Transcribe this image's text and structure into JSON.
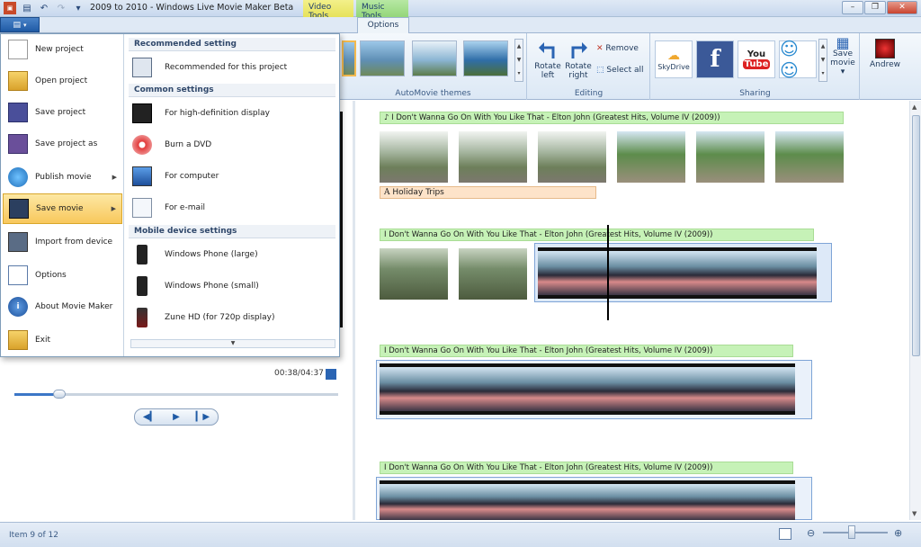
{
  "window": {
    "title": "2009 to 2010 - Windows Live Movie Maker Beta"
  },
  "context_tabs": {
    "video": "Video Tools",
    "music": "Music Tools"
  },
  "ribbon": {
    "active_tab": "Options",
    "groups": {
      "themes": "AutoMovie themes",
      "editing": "Editing",
      "sharing": "Sharing"
    },
    "editing": {
      "rotate_left": [
        "Rotate",
        "left"
      ],
      "rotate_right": [
        "Rotate",
        "right"
      ],
      "remove": "Remove",
      "select_all": "Select all"
    },
    "sharing": {
      "skydrive": "SkyDrive",
      "save_movie": [
        "Save",
        "movie"
      ],
      "user": "Andrew"
    }
  },
  "file_menu": {
    "left": [
      {
        "label": "New project"
      },
      {
        "label": "Open project"
      },
      {
        "label": "Save project"
      },
      {
        "label": "Save project as"
      },
      {
        "label": "Publish movie",
        "submenu": true
      },
      {
        "label": "Save movie",
        "submenu": true,
        "active": true
      },
      {
        "label": "Import from device"
      },
      {
        "label": "Options"
      },
      {
        "label": "About Movie Maker"
      },
      {
        "label": "Exit"
      }
    ],
    "right": {
      "recommended_header": "Recommended setting",
      "recommended_item": "Recommended for this project",
      "common_header": "Common settings",
      "common": [
        "For high-definition display",
        "Burn a DVD",
        "For computer",
        "For e-mail"
      ],
      "mobile_header": "Mobile device settings",
      "mobile": [
        "Windows Phone (large)",
        "Windows Phone (small)",
        "Zune HD (for 720p display)"
      ]
    }
  },
  "player": {
    "timecode": "00:38/04:37",
    "position": 0.14
  },
  "storyboard": {
    "music_track": "I Don't Wanna Go On With You Like That - Elton John (Greatest Hits, Volume IV (2009))",
    "caption": "Holiday Trips"
  },
  "status": {
    "item": "Item 9 of 12"
  }
}
